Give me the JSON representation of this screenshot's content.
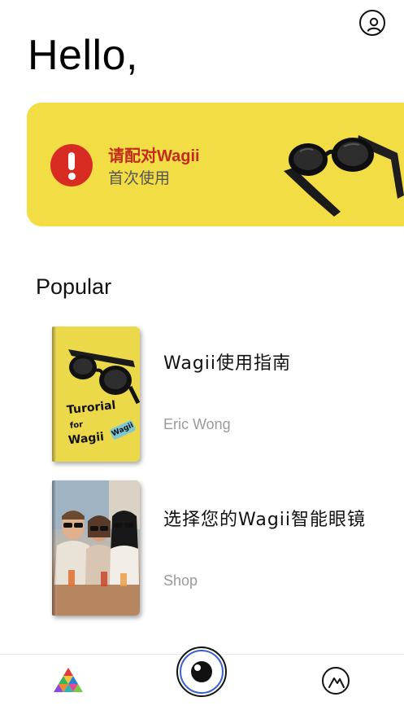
{
  "header": {
    "greeting": "Hello,",
    "profile_icon": "user-circle-icon"
  },
  "pair_banner": {
    "title": "请配对Wagii",
    "subtitle": "首次使用",
    "alert_icon": "exclamation-circle-icon",
    "background_color": "#f3dd45",
    "title_color": "#c42b1f"
  },
  "popular": {
    "section_title": "Popular",
    "items": [
      {
        "title": "Wagii使用指南",
        "subtitle": "Eric Wong",
        "cover": {
          "line1": "Turorial",
          "line2": "for",
          "line3": "Wagii",
          "badge": "Wagii"
        }
      },
      {
        "title": "选择您的Wagii智能眼镜",
        "subtitle": "Shop"
      }
    ]
  },
  "tab_bar": {
    "left_icon": "colorful-triangle-icon",
    "center_icon": "camera-eye-icon",
    "right_icon": "mountain-circle-icon"
  }
}
